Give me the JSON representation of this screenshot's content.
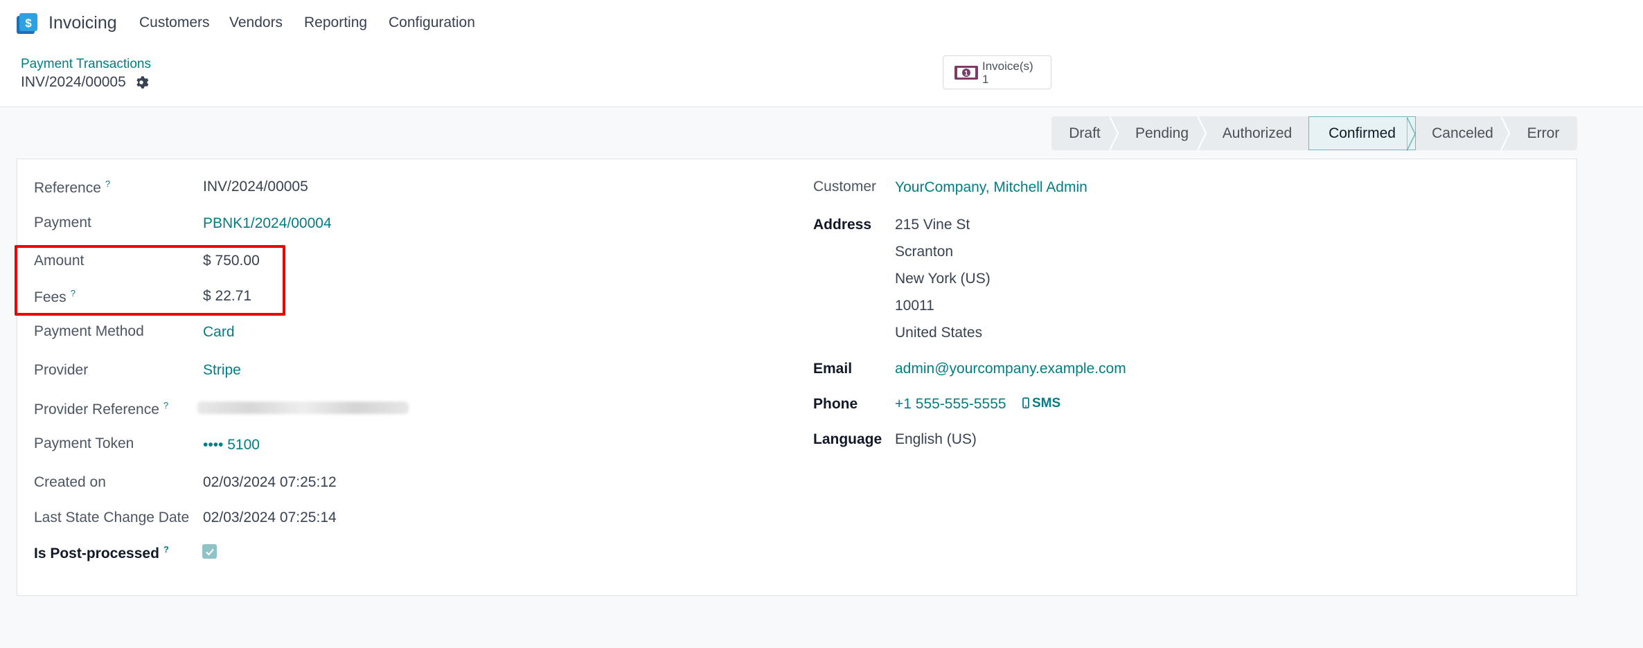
{
  "navbar": {
    "app_name": "Invoicing",
    "menus": [
      "Customers",
      "Vendors",
      "Reporting",
      "Configuration"
    ]
  },
  "control_panel": {
    "breadcrumb": "Payment Transactions",
    "record_title": "INV/2024/00005",
    "smart_button": {
      "label": "Invoice(s)",
      "value": "1"
    }
  },
  "statusbar": {
    "stages": [
      "Draft",
      "Pending",
      "Authorized",
      "Confirmed",
      "Canceled",
      "Error"
    ],
    "active": "Confirmed"
  },
  "left_fields": {
    "reference": {
      "label": "Reference",
      "value": "INV/2024/00005",
      "help": "?"
    },
    "payment": {
      "label": "Payment",
      "value": "PBNK1/2024/00004"
    },
    "amount": {
      "label": "Amount",
      "value": "$ 750.00"
    },
    "fees": {
      "label": "Fees",
      "value": "$ 22.71",
      "help": "?"
    },
    "payment_method": {
      "label": "Payment Method",
      "value": "Card"
    },
    "provider": {
      "label": "Provider",
      "value": "Stripe"
    },
    "provider_reference": {
      "label": "Provider Reference",
      "help": "?"
    },
    "payment_token": {
      "label": "Payment Token",
      "value": "•••• 5100"
    },
    "created_on": {
      "label": "Created on",
      "value": "02/03/2024 07:25:12"
    },
    "last_state_change": {
      "label": "Last State Change Date",
      "value": "02/03/2024 07:25:14"
    },
    "is_post_processed": {
      "label": "Is Post-processed",
      "help": "?",
      "checked": true
    }
  },
  "right_fields": {
    "customer": {
      "label": "Customer",
      "value": "YourCompany, Mitchell Admin"
    },
    "address": {
      "label": "Address",
      "street": "215 Vine St",
      "city": "Scranton",
      "state": "New York (US)",
      "zip": "10011",
      "country": "United States"
    },
    "email": {
      "label": "Email",
      "value": "admin@yourcompany.example.com"
    },
    "phone": {
      "label": "Phone",
      "value": "+1 555-555-5555",
      "sms": "SMS"
    },
    "language": {
      "label": "Language",
      "value": "English (US)"
    }
  },
  "colors": {
    "accent": "#017e84",
    "highlight": "#ee0000",
    "active_stage_bg": "#e6f2f3"
  }
}
